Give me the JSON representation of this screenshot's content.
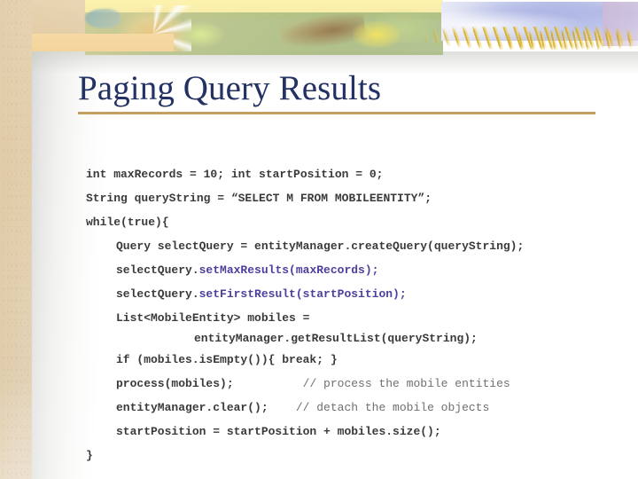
{
  "slide": {
    "title": "Paging Query Results",
    "accent_rule_color": "#c79e62",
    "title_color": "#233163",
    "code_color": "#3a3a3a",
    "highlight_color": "#4b3f9e",
    "comment_color": "#6f6f6f"
  },
  "banner": {
    "name": "decorative-header-banner",
    "colors": [
      "#f8edaa",
      "#aabc84",
      "#c0c7ea",
      "#d4a818",
      "#f3d49c"
    ]
  },
  "code": {
    "lines": [
      {
        "indent": 0,
        "parts": [
          {
            "text": "int maxRecords = 10; int startPosition = 0;",
            "style": "plain"
          }
        ]
      },
      {
        "indent": 0,
        "parts": [
          {
            "text": "String queryString = “SELECT M FROM MOBILEENTITY”;",
            "style": "plain"
          }
        ]
      },
      {
        "indent": 0,
        "parts": [
          {
            "text": "while(true){",
            "style": "plain"
          }
        ]
      },
      {
        "indent": 1,
        "parts": [
          {
            "text": "Query selectQuery = entityManager.createQuery(queryString);",
            "style": "plain"
          }
        ]
      },
      {
        "indent": 1,
        "parts": [
          {
            "text": "selectQuery.",
            "style": "plain"
          },
          {
            "text": "setMaxResults(maxRecords);",
            "style": "highlight"
          }
        ]
      },
      {
        "indent": 1,
        "parts": [
          {
            "text": "selectQuery.",
            "style": "plain"
          },
          {
            "text": "setFirstResult(startPosition);",
            "style": "highlight"
          }
        ]
      },
      {
        "indent": 1,
        "parts": [
          {
            "text": "List<MobileEntity> mobiles =",
            "style": "plain"
          }
        ]
      },
      {
        "indent": 2,
        "parts": [
          {
            "text": "entityManager.getResultList(queryString);",
            "style": "plain"
          }
        ]
      },
      {
        "indent": 1,
        "parts": [
          {
            "text": "if (mobiles.isEmpty()){ break; }",
            "style": "plain"
          }
        ]
      },
      {
        "indent": 1,
        "parts": [
          {
            "text": "process(mobiles);          ",
            "style": "plain"
          },
          {
            "text": "// process the mobile entities",
            "style": "comment"
          }
        ]
      },
      {
        "indent": 1,
        "parts": [
          {
            "text": "entityManager.clear();    ",
            "style": "plain"
          },
          {
            "text": "// detach the mobile objects",
            "style": "comment"
          }
        ]
      },
      {
        "indent": 1,
        "parts": [
          {
            "text": "startPosition = startPosition + mobiles.size();",
            "style": "plain"
          }
        ]
      },
      {
        "indent": 0,
        "parts": [
          {
            "text": "}",
            "style": "plain"
          }
        ]
      }
    ]
  }
}
